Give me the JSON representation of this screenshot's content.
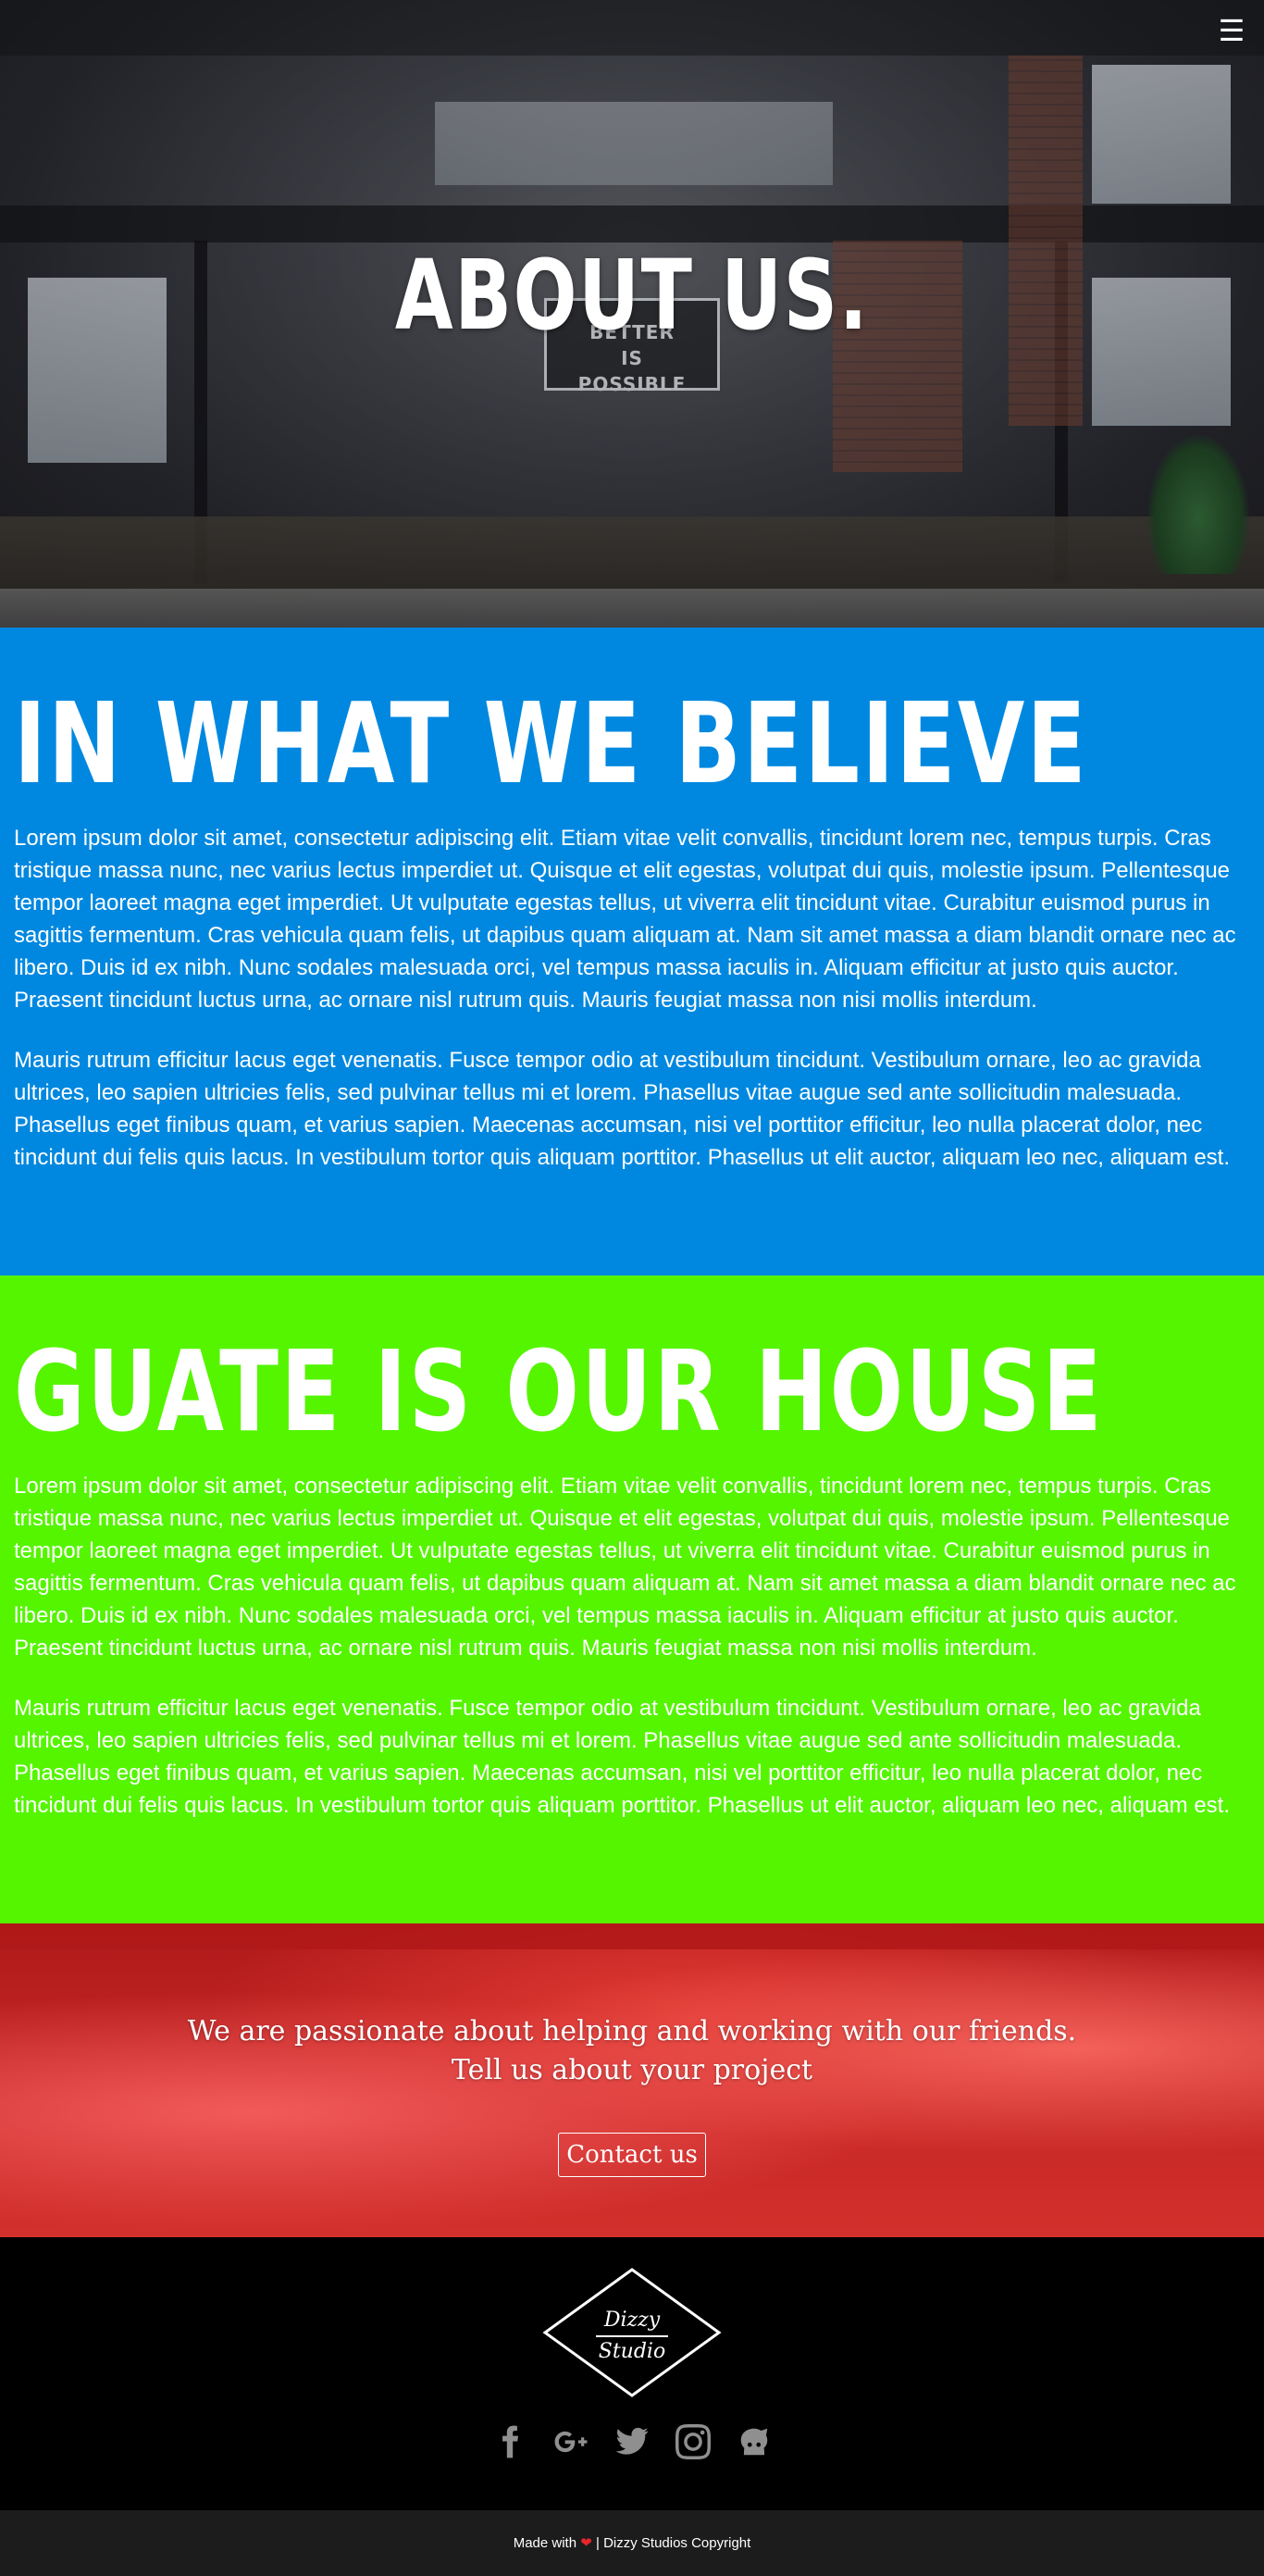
{
  "hero": {
    "title": "ABOUT US.",
    "menu_icon": "hamburger-menu-icon",
    "sign_text": "BETTER\nIS\nPOSSIBLE"
  },
  "belief": {
    "heading": "IN WHAT WE BELIEVE",
    "paragraphs": [
      "Lorem ipsum dolor sit amet, consectetur adipiscing elit. Etiam vitae velit convallis, tincidunt lorem nec, tempus turpis. Cras tristique massa nunc, nec varius lectus imperdiet ut. Quisque et elit egestas, volutpat dui quis, molestie ipsum. Pellentesque tempor laoreet magna eget imperdiet. Ut vulputate egestas tellus, ut viverra elit tincidunt vitae. Curabitur euismod purus in sagittis fermentum. Cras vehicula quam felis, ut dapibus quam aliquam at. Nam sit amet massa a diam blandit ornare nec ac libero. Duis id ex nibh. Nunc sodales malesuada orci, vel tempus massa iaculis in. Aliquam efficitur at justo quis auctor. Praesent tincidunt luctus urna, ac ornare nisl rutrum quis. Mauris feugiat massa non nisi mollis interdum.",
      "Mauris rutrum efficitur lacus eget venenatis. Fusce tempor odio at vestibulum tincidunt. Vestibulum ornare, leo ac gravida ultrices, leo sapien ultricies felis, sed pulvinar tellus mi et lorem. Phasellus vitae augue sed ante sollicitudin malesuada. Phasellus eget finibus quam, et varius sapien. Maecenas accumsan, nisi vel porttitor efficitur, leo nulla placerat dolor, nec tincidunt dui felis quis lacus. In vestibulum tortor quis aliquam porttitor. Phasellus ut elit auctor, aliquam leo nec, aliquam est."
    ]
  },
  "house": {
    "heading": "GUATE IS OUR HOUSE",
    "paragraphs": [
      "Lorem ipsum dolor sit amet, consectetur adipiscing elit. Etiam vitae velit convallis, tincidunt lorem nec, tempus turpis. Cras tristique massa nunc, nec varius lectus imperdiet ut. Quisque et elit egestas, volutpat dui quis, molestie ipsum. Pellentesque tempor laoreet magna eget imperdiet. Ut vulputate egestas tellus, ut viverra elit tincidunt vitae. Curabitur euismod purus in sagittis fermentum. Cras vehicula quam felis, ut dapibus quam aliquam at. Nam sit amet massa a diam blandit ornare nec ac libero. Duis id ex nibh. Nunc sodales malesuada orci, vel tempus massa iaculis in. Aliquam efficitur at justo quis auctor. Praesent tincidunt luctus urna, ac ornare nisl rutrum quis. Mauris feugiat massa non nisi mollis interdum.",
      "Mauris rutrum efficitur lacus eget venenatis. Fusce tempor odio at vestibulum tincidunt. Vestibulum ornare, leo ac gravida ultrices, leo sapien ultricies felis, sed pulvinar tellus mi et lorem. Phasellus vitae augue sed ante sollicitudin malesuada. Phasellus eget finibus quam, et varius sapien. Maecenas accumsan, nisi vel porttitor efficitur, leo nulla placerat dolor, nec tincidunt dui felis quis lacus. In vestibulum tortor quis aliquam porttitor. Phasellus ut elit auctor, aliquam leo nec, aliquam est."
    ]
  },
  "cta": {
    "line1": "We are passionate about helping and working with our friends.",
    "line2": "Tell us about your project",
    "button_label": "Contact us"
  },
  "footer": {
    "logo_line1": "Dizzy",
    "logo_line2": "Studio",
    "socials": [
      "facebook-icon",
      "google-plus-icon",
      "twitter-icon",
      "instagram-icon",
      "github-icon"
    ],
    "made_with": "Made with",
    "heart": "❤",
    "copyright": "| Dizzy Studios Copyright"
  },
  "colors": {
    "belief_bg": "#0088e0",
    "house_bg": "#55f500",
    "cta_bg": "#d3302c",
    "footer_bg": "#000000",
    "copyright_bg": "#1c1c1c",
    "heart": "#e8262c"
  }
}
